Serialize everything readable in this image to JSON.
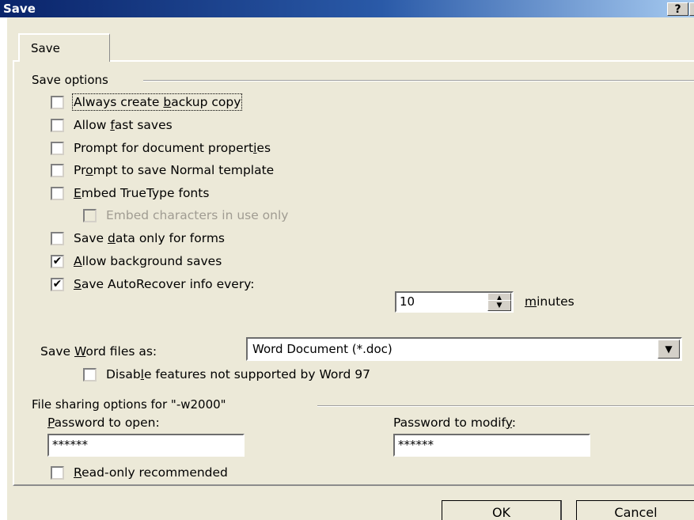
{
  "window": {
    "title": "Save",
    "help_label": "?",
    "close_label": "×"
  },
  "tabs": [
    {
      "label": "Save"
    }
  ],
  "save_options": {
    "heading": "Save options",
    "items": [
      {
        "pre": "Always create ",
        "key": "b",
        "post": "ackup copy",
        "checked": false,
        "disabled": false,
        "focused": true
      },
      {
        "pre": "Allow ",
        "key": "f",
        "post": "ast saves",
        "checked": false,
        "disabled": false
      },
      {
        "pre": "Prompt for document propert",
        "key": "i",
        "post": "es",
        "checked": false,
        "disabled": false
      },
      {
        "pre": "Pr",
        "key": "o",
        "post": "mpt to save Normal template",
        "checked": false,
        "disabled": false
      },
      {
        "pre": "",
        "key": "E",
        "post": "mbed TrueType fonts",
        "checked": false,
        "disabled": false
      },
      {
        "pre": "Embed characters in use only",
        "key": "",
        "post": "",
        "checked": false,
        "disabled": true,
        "indent": true
      },
      {
        "pre": "Save ",
        "key": "d",
        "post": "ata only for forms",
        "checked": false,
        "disabled": false
      },
      {
        "pre": "",
        "key": "A",
        "post": "llow background saves",
        "checked": true,
        "disabled": false
      },
      {
        "pre": "",
        "key": "S",
        "post": "ave AutoRecover info every:",
        "checked": true,
        "disabled": false
      }
    ],
    "autorecover_value": "10",
    "minutes_label": {
      "pre": "",
      "key": "m",
      "post": "inutes"
    }
  },
  "save_as": {
    "label": {
      "pre": "Save ",
      "key": "W",
      "post": "ord files as:"
    },
    "selected": "Word Document (*.doc)",
    "disable_features": {
      "pre": "Disab",
      "key": "l",
      "post": "e features not supported by Word 97",
      "checked": false
    }
  },
  "file_sharing": {
    "heading": "File sharing options for \"-w2000\"",
    "open_label": {
      "pre": "",
      "key": "P",
      "post": "assword to open:"
    },
    "open_value": "******",
    "modify_label": {
      "pre": "Password to modif",
      "key": "y",
      "post": ":"
    },
    "modify_value": "******",
    "readonly": {
      "pre": "",
      "key": "R",
      "post": "ead-only recommended",
      "checked": false
    }
  },
  "buttons": {
    "ok": "OK",
    "cancel": "Cancel"
  },
  "icons": {
    "check": "✔",
    "spin_up": "▲",
    "spin_down": "▼",
    "dropdown": "▼"
  }
}
